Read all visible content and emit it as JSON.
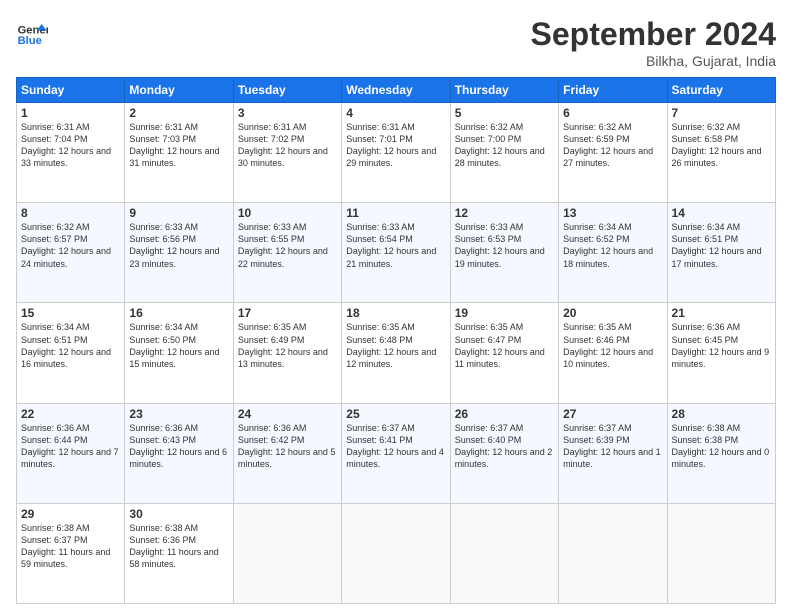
{
  "header": {
    "logo_line1": "General",
    "logo_line2": "Blue",
    "month_title": "September 2024",
    "location": "Bilkha, Gujarat, India"
  },
  "days_of_week": [
    "Sunday",
    "Monday",
    "Tuesday",
    "Wednesday",
    "Thursday",
    "Friday",
    "Saturday"
  ],
  "weeks": [
    [
      {
        "day": "1",
        "sunrise": "6:31 AM",
        "sunset": "7:04 PM",
        "daylight": "12 hours and 33 minutes."
      },
      {
        "day": "2",
        "sunrise": "6:31 AM",
        "sunset": "7:03 PM",
        "daylight": "12 hours and 31 minutes."
      },
      {
        "day": "3",
        "sunrise": "6:31 AM",
        "sunset": "7:02 PM",
        "daylight": "12 hours and 30 minutes."
      },
      {
        "day": "4",
        "sunrise": "6:31 AM",
        "sunset": "7:01 PM",
        "daylight": "12 hours and 29 minutes."
      },
      {
        "day": "5",
        "sunrise": "6:32 AM",
        "sunset": "7:00 PM",
        "daylight": "12 hours and 28 minutes."
      },
      {
        "day": "6",
        "sunrise": "6:32 AM",
        "sunset": "6:59 PM",
        "daylight": "12 hours and 27 minutes."
      },
      {
        "day": "7",
        "sunrise": "6:32 AM",
        "sunset": "6:58 PM",
        "daylight": "12 hours and 26 minutes."
      }
    ],
    [
      {
        "day": "8",
        "sunrise": "6:32 AM",
        "sunset": "6:57 PM",
        "daylight": "12 hours and 24 minutes."
      },
      {
        "day": "9",
        "sunrise": "6:33 AM",
        "sunset": "6:56 PM",
        "daylight": "12 hours and 23 minutes."
      },
      {
        "day": "10",
        "sunrise": "6:33 AM",
        "sunset": "6:55 PM",
        "daylight": "12 hours and 22 minutes."
      },
      {
        "day": "11",
        "sunrise": "6:33 AM",
        "sunset": "6:54 PM",
        "daylight": "12 hours and 21 minutes."
      },
      {
        "day": "12",
        "sunrise": "6:33 AM",
        "sunset": "6:53 PM",
        "daylight": "12 hours and 19 minutes."
      },
      {
        "day": "13",
        "sunrise": "6:34 AM",
        "sunset": "6:52 PM",
        "daylight": "12 hours and 18 minutes."
      },
      {
        "day": "14",
        "sunrise": "6:34 AM",
        "sunset": "6:51 PM",
        "daylight": "12 hours and 17 minutes."
      }
    ],
    [
      {
        "day": "15",
        "sunrise": "6:34 AM",
        "sunset": "6:51 PM",
        "daylight": "12 hours and 16 minutes."
      },
      {
        "day": "16",
        "sunrise": "6:34 AM",
        "sunset": "6:50 PM",
        "daylight": "12 hours and 15 minutes."
      },
      {
        "day": "17",
        "sunrise": "6:35 AM",
        "sunset": "6:49 PM",
        "daylight": "12 hours and 13 minutes."
      },
      {
        "day": "18",
        "sunrise": "6:35 AM",
        "sunset": "6:48 PM",
        "daylight": "12 hours and 12 minutes."
      },
      {
        "day": "19",
        "sunrise": "6:35 AM",
        "sunset": "6:47 PM",
        "daylight": "12 hours and 11 minutes."
      },
      {
        "day": "20",
        "sunrise": "6:35 AM",
        "sunset": "6:46 PM",
        "daylight": "12 hours and 10 minutes."
      },
      {
        "day": "21",
        "sunrise": "6:36 AM",
        "sunset": "6:45 PM",
        "daylight": "12 hours and 9 minutes."
      }
    ],
    [
      {
        "day": "22",
        "sunrise": "6:36 AM",
        "sunset": "6:44 PM",
        "daylight": "12 hours and 7 minutes."
      },
      {
        "day": "23",
        "sunrise": "6:36 AM",
        "sunset": "6:43 PM",
        "daylight": "12 hours and 6 minutes."
      },
      {
        "day": "24",
        "sunrise": "6:36 AM",
        "sunset": "6:42 PM",
        "daylight": "12 hours and 5 minutes."
      },
      {
        "day": "25",
        "sunrise": "6:37 AM",
        "sunset": "6:41 PM",
        "daylight": "12 hours and 4 minutes."
      },
      {
        "day": "26",
        "sunrise": "6:37 AM",
        "sunset": "6:40 PM",
        "daylight": "12 hours and 2 minutes."
      },
      {
        "day": "27",
        "sunrise": "6:37 AM",
        "sunset": "6:39 PM",
        "daylight": "12 hours and 1 minute."
      },
      {
        "day": "28",
        "sunrise": "6:38 AM",
        "sunset": "6:38 PM",
        "daylight": "12 hours and 0 minutes."
      }
    ],
    [
      {
        "day": "29",
        "sunrise": "6:38 AM",
        "sunset": "6:37 PM",
        "daylight": "11 hours and 59 minutes."
      },
      {
        "day": "30",
        "sunrise": "6:38 AM",
        "sunset": "6:36 PM",
        "daylight": "11 hours and 58 minutes."
      },
      null,
      null,
      null,
      null,
      null
    ]
  ]
}
